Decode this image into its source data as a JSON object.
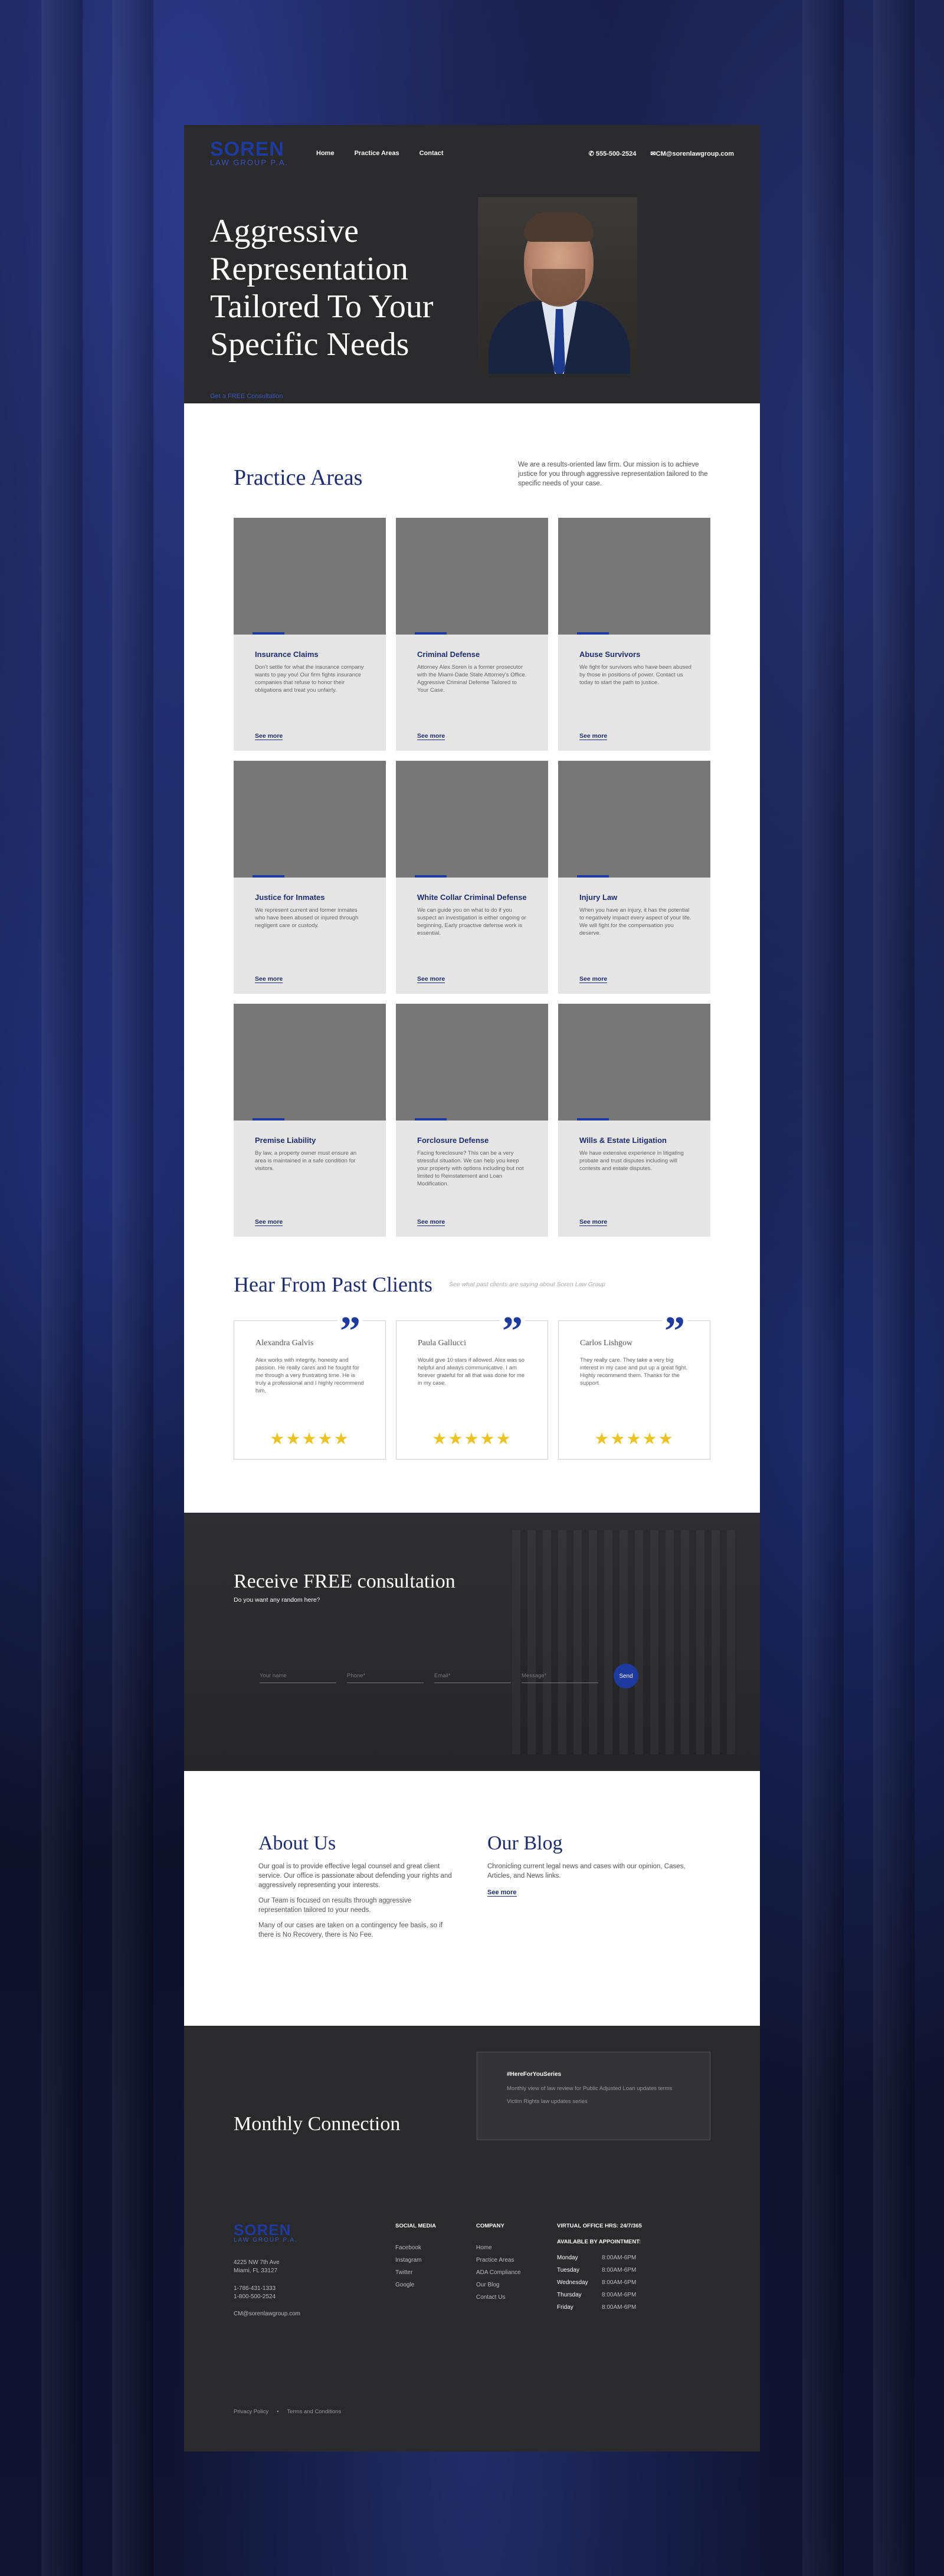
{
  "brand": {
    "name": "SOREN",
    "tagline": "LAW GROUP P.A."
  },
  "nav": {
    "items": [
      "Home",
      "Practice Areas",
      "Contact"
    ],
    "phone": "555-500-2524",
    "email": "CM@sorenlawgroup.com"
  },
  "hero": {
    "headline_lines": [
      "Aggressive",
      "Representation",
      "Tailored To Your",
      "Specific Needs"
    ],
    "sub": "Get a FREE Consultation"
  },
  "practice": {
    "title": "Practice Areas",
    "intro": "We are a results-oriented law firm. Our mission is to achieve justice for you through aggressive representation tailored to the specific needs of your case.",
    "more_label": "See more",
    "cards": [
      {
        "title": "Insurance Claims",
        "text": "Don't settle for what the insurance company wants to pay you! Our firm fights insurance companies that refuse to honor their obligations and treat you unfairly."
      },
      {
        "title": "Criminal Defense",
        "text": "Attorney Alex Soren is a former prosecutor with the Miami-Dade State Attorney's Office. Aggressive Criminal Defense Tailored to Your Case."
      },
      {
        "title": "Abuse Survivors",
        "text": "We fight for survivors who have been abused by those in positions of power. Contact us today to start the path to justice."
      },
      {
        "title": "Justice for Inmates",
        "text": "We represent current and former inmates who have been abused or injured through negligent care or custody."
      },
      {
        "title": "White Collar Criminal Defense",
        "text": "We can guide you on what to do if you suspect an investigation is either ongoing or beginning. Early proactive defense work is essential."
      },
      {
        "title": "Injury Law",
        "text": "When you have an injury, it has the potential to negatively impact every aspect of your life. We will fight for the compensation you deserve."
      },
      {
        "title": "Premise Liability",
        "text": "By law, a property owner must ensure an area is maintained in a safe condition for visitors."
      },
      {
        "title": "Forclosure  Defense",
        "text": "Facing foreclosure? This can be a very stressful situation. We can help you keep your property with options including but not limited to Reinstatement and Loan Modification."
      },
      {
        "title": "Wills & Estate Litigation",
        "text": "We have extensive experience in litigating probate and trust disputes including will contests and estate disputes."
      }
    ]
  },
  "clients": {
    "title": "Hear From Past Clients",
    "sub": "See what past clients are saying about Soren Law Group",
    "reviews": [
      {
        "name": "Alexandra Galvis",
        "text": "Alex works with integrity, honesty and passion. He really cares and he fought for me through a very frustrating time. He is truly a professional and I highly recommend him.",
        "stars": "★★★★★"
      },
      {
        "name": "Paula Gallucci",
        "text": "Would give 10 stars if allowed. Alex was so helpful and always communicative. I am forever grateful for all that was done for me in my case.",
        "stars": "★★★★★"
      },
      {
        "name": "Carlos Lishgow",
        "text": "They really care. They take a very big interest in my case and put up a great fight. Highly recommend them. Thanks for the support.",
        "stars": "★★★★★"
      }
    ]
  },
  "consult": {
    "title": "Receive FREE consultation",
    "sub": "Do you want any random here?",
    "fields": [
      "Your name",
      "Phone*",
      "Email*",
      "Message*"
    ],
    "send": "Send"
  },
  "about": {
    "title": "About Us",
    "paras": [
      "Our goal is to provide effective legal counsel and great client service. Our office is passionate about defending your rights and aggressively representing your interests.",
      "Our Team is focused on results through aggressive representation tailored to your needs.",
      "Many of our cases are taken on a contingency fee basis, so if there is No Recovery, there is No Fee."
    ]
  },
  "blog": {
    "title": "Our Blog",
    "text": "Chronicling current legal news and cases with our opinion, Cases, Articles, and News links.",
    "more": "See more"
  },
  "monthly": {
    "title": "Monthly Connection",
    "box_title": "#HereForYouSeries",
    "lines": [
      "Monthly view of law review for Public Adjusted Loan updates terms",
      "Victim Rights law updates series"
    ]
  },
  "footer": {
    "address": [
      "4225 NW 7th Ave",
      "Miami, FL 33127"
    ],
    "phones": [
      "1-786-431-1333",
      "1-800-500-2524"
    ],
    "email": "CM@sorenlawgroup.com",
    "social_title": "SOCIAL MEDIA",
    "social": [
      "Facebook",
      "Instagram",
      "Twitter",
      "Google"
    ],
    "company_title": "COMPANY",
    "company": [
      "Home",
      "Practice Areas",
      "ADA Compliance",
      "Our Blog",
      "Contact Us"
    ],
    "virtual_title": "VIRTUAL OFFICE HRS: 24/7/365",
    "appt_title": "AVAILABLE BY APPOINTMENT:",
    "hours": [
      {
        "day": "Monday",
        "time": "8:00AM-6PM"
      },
      {
        "day": "Tuesday",
        "time": "8:00AM-6PM"
      },
      {
        "day": "Wednesday",
        "time": "8:00AM-6PM"
      },
      {
        "day": "Thursday",
        "time": "8:00AM-6PM"
      },
      {
        "day": "Friday",
        "time": "8:00AM-6PM"
      }
    ],
    "legal": [
      "Privacy Policy",
      "Terms and Conditions"
    ]
  },
  "colors": {
    "accent": "#1e3a9e",
    "navy": "#1f2d6e",
    "dark": "#2a2a2d",
    "star": "#e9c422"
  }
}
